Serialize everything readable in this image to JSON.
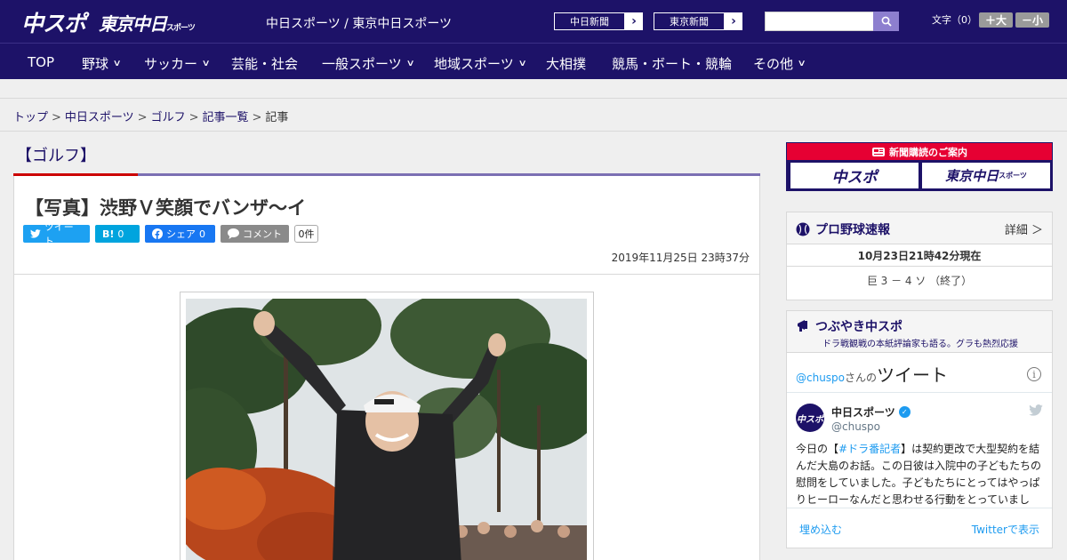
{
  "header": {
    "logo_main": "中スポ",
    "logo_tokyo": "東京中日",
    "logo_tokyo_small": "スポーツ",
    "site_title": "中日スポーツ / 東京中日スポーツ",
    "links": [
      "中日新聞",
      "東京新聞"
    ],
    "fontsize_label": "文字（0）",
    "fontsize_up": "＋大",
    "fontsize_down": "－小"
  },
  "nav": [
    {
      "label": "TOP",
      "has_menu": false
    },
    {
      "label": "野球",
      "has_menu": true
    },
    {
      "label": "サッカー",
      "has_menu": true
    },
    {
      "label": "芸能・社会",
      "has_menu": false
    },
    {
      "label": "一般スポーツ",
      "has_menu": true
    },
    {
      "label": "地域スポーツ",
      "has_menu": true
    },
    {
      "label": "大相撲",
      "has_menu": false
    },
    {
      "label": "競馬・ボート・競輪",
      "has_menu": false
    },
    {
      "label": "その他",
      "has_menu": true
    }
  ],
  "breadcrumb": {
    "items": [
      "トップ",
      "中日スポーツ",
      "ゴルフ",
      "記事一覧"
    ],
    "current": "記事",
    "separator": ">"
  },
  "article": {
    "section": "【ゴルフ】",
    "title": "【写真】渋野Ｖ笑顔でバンザ～イ",
    "date": "2019年11月25日 23時37分",
    "share": {
      "tweet": "ツイート",
      "hatena": "B!",
      "hatena_count": "0",
      "facebook": "シェア",
      "facebook_count": "0",
      "comment": "コメント",
      "comment_count": "0件"
    }
  },
  "sidebar": {
    "ad": {
      "title": "新聞購読のご案内",
      "btn1": "中スポ",
      "btn2": "東京中日",
      "btn2_small": "スポーツ"
    },
    "baseball": {
      "title": "プロ野球速報",
      "detail": "詳細 ＞",
      "date": "10月23日21時42分現在",
      "score": "巨 3 － 4 ソ （終了）"
    },
    "tweets": {
      "title": "つぶやき中スポ",
      "subtitle": "ドラ戦観戦の本紙評論家も語る。グラも熱烈応援",
      "timeline_user": "@chuspo",
      "timeline_suffix": "さんの",
      "timeline_label": "ツイート",
      "account_name": "中日スポーツ",
      "account_handle": "@chuspo",
      "avatar_text": "中スポ",
      "text_pre": "今日の【",
      "text_tag": "#ドラ番記者",
      "text_post": "】は契約更改で大型契約を結んだ大島のお話。この日彼は入院中の子どもたちの慰問をしていました。子どもたちにとってはやっぱりヒーローなんだと思わせる行動をとっていまし",
      "embed": "埋め込む",
      "view": "Twitterで表示"
    }
  },
  "colors": {
    "brand": "#1d1268",
    "accent_red": "#e60033",
    "twitter": "#1da1f2",
    "facebook": "#1877f2"
  }
}
